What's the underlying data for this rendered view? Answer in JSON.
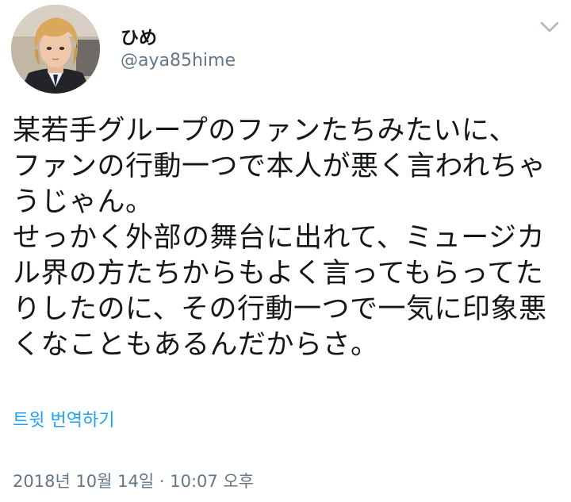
{
  "user": {
    "display_name": "ひめ",
    "handle": "@aya85hime",
    "avatar_icon": "avatar-photo"
  },
  "menu": {
    "icon": "chevron-down-icon"
  },
  "tweet": {
    "lines": [
      "某若手グループのファンたちみたいに、",
      "ファンの行動一つで本人が悪く言われちゃ",
      "うじゃん。",
      "せっかく外部の舞台に出れて、ミュージカ",
      "ル界の方たちからもよく言ってもらってた",
      "りしたのに、その行動一つで一気に印象悪",
      "くなこともあるんだからさ。"
    ]
  },
  "translate_link": "트윗 번역하기",
  "timestamp": "2018년 10월 14일 · 10:07 오후",
  "colors": {
    "text": "#14171a",
    "secondary": "#657786",
    "link": "#1da1f2"
  }
}
